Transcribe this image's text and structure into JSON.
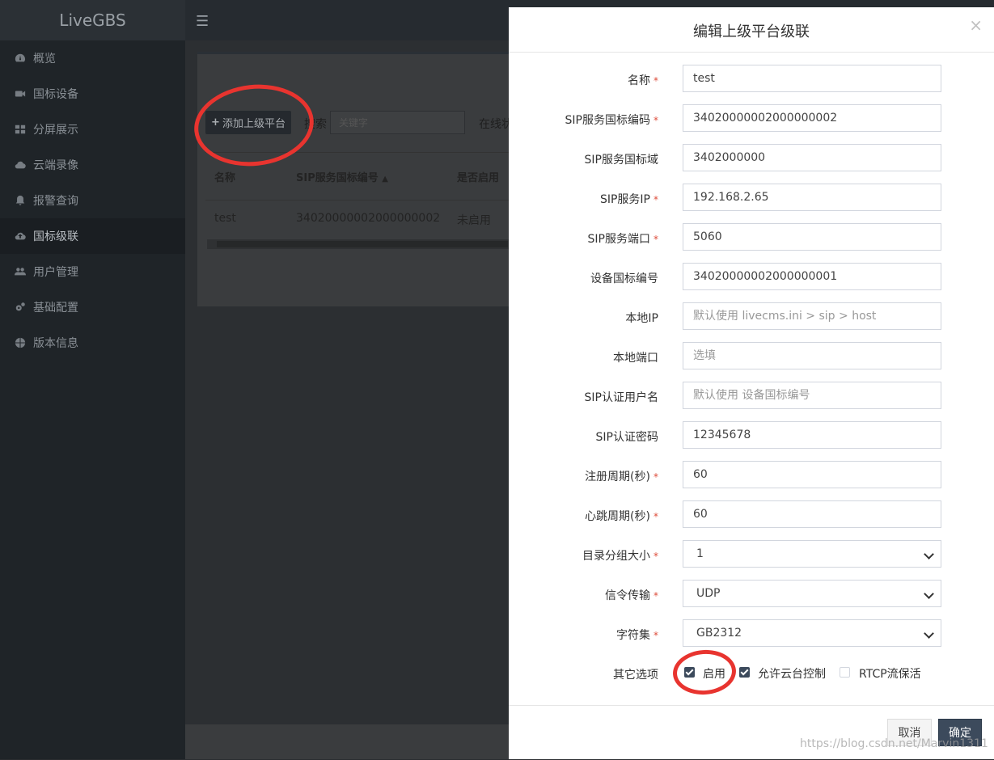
{
  "app": {
    "brand": "LiveGBS"
  },
  "sidebar": {
    "items": [
      {
        "label": "概览",
        "icon": "dashboard-icon"
      },
      {
        "label": "国标设备",
        "icon": "video-camera-icon"
      },
      {
        "label": "分屏展示",
        "icon": "grid-icon"
      },
      {
        "label": "云端录像",
        "icon": "cloud-icon"
      },
      {
        "label": "报警查询",
        "icon": "bell-icon"
      },
      {
        "label": "国标级联",
        "icon": "cloud-upload-icon",
        "active": true
      },
      {
        "label": "用户管理",
        "icon": "users-icon"
      },
      {
        "label": "基础配置",
        "icon": "gears-icon"
      },
      {
        "label": "版本信息",
        "icon": "globe-icon"
      }
    ]
  },
  "page": {
    "add_button": "添加上级平台",
    "search_label": "搜索",
    "search_placeholder": "关键字",
    "status_label": "在线状",
    "table": {
      "headers": [
        "名称",
        "SIP服务国标编号",
        "是否启用"
      ],
      "rows": [
        [
          "test",
          "34020000002000000002",
          "未启用"
        ]
      ]
    }
  },
  "modal": {
    "title": "编辑上级平台级联",
    "fields": [
      {
        "label": "名称",
        "required": true,
        "value": "test",
        "placeholder": ""
      },
      {
        "label": "SIP服务国标编码",
        "required": true,
        "value": "34020000002000000002",
        "placeholder": ""
      },
      {
        "label": "SIP服务国标域",
        "required": false,
        "value": "3402000000",
        "placeholder": ""
      },
      {
        "label": "SIP服务IP",
        "required": true,
        "value": "192.168.2.65",
        "placeholder": ""
      },
      {
        "label": "SIP服务端口",
        "required": true,
        "value": "5060",
        "placeholder": ""
      },
      {
        "label": "设备国标编号",
        "required": false,
        "value": "34020000002000000001",
        "placeholder": ""
      },
      {
        "label": "本地IP",
        "required": false,
        "value": "",
        "placeholder": "默认使用 livecms.ini > sip > host"
      },
      {
        "label": "本地端口",
        "required": false,
        "value": "",
        "placeholder": "选填"
      },
      {
        "label": "SIP认证用户名",
        "required": false,
        "value": "",
        "placeholder": "默认使用 设备国标编号"
      },
      {
        "label": "SIP认证密码",
        "required": false,
        "value": "12345678",
        "placeholder": ""
      },
      {
        "label": "注册周期(秒)",
        "required": true,
        "value": "60",
        "placeholder": ""
      },
      {
        "label": "心跳周期(秒)",
        "required": true,
        "value": "60",
        "placeholder": ""
      }
    ],
    "selects": [
      {
        "label": "目录分组大小",
        "required": true,
        "value": "1"
      },
      {
        "label": "信令传输",
        "required": true,
        "value": "UDP"
      },
      {
        "label": "字符集",
        "required": true,
        "value": "GB2312"
      }
    ],
    "other_options": {
      "label": "其它选项",
      "items": [
        {
          "label": "启用",
          "checked": true
        },
        {
          "label": "允许云台控制",
          "checked": true
        },
        {
          "label": "RTCP流保活",
          "checked": false
        }
      ]
    },
    "required_mark": "*",
    "cancel_label": "取消",
    "ok_label": "确定"
  },
  "watermark": "https://blog.csdn.net/Marvin1311",
  "colors": {
    "annotation_red": "#e8342f",
    "primary_button": "#3c4a5c",
    "required_star": "#dd4b39"
  }
}
